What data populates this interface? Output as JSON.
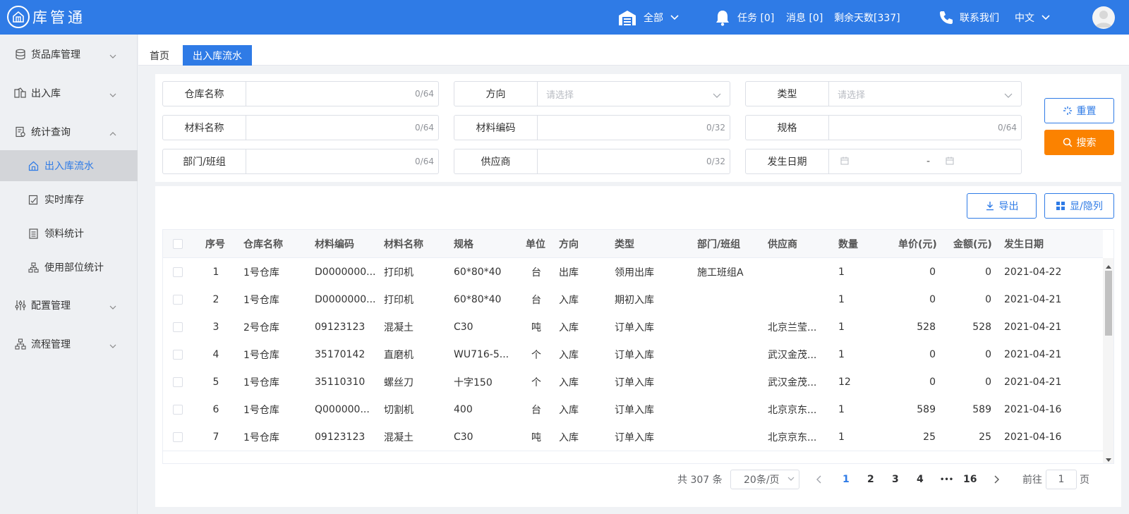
{
  "app": {
    "name": "库管通"
  },
  "header": {
    "warehouse_label": "全部",
    "tasks": "任务 [0]",
    "messages": "消息 [0]",
    "remaining_days": "剩余天数[337]",
    "contact": "联系我们",
    "language": "中文"
  },
  "sidebar": {
    "items": [
      {
        "label": "货品库管理",
        "icon": "database-icon",
        "expanded": false
      },
      {
        "label": "出入库",
        "icon": "swap-icon",
        "expanded": false
      },
      {
        "label": "统计查询",
        "icon": "stats-icon",
        "expanded": true
      },
      {
        "label": "配置管理",
        "icon": "sliders-icon",
        "expanded": false
      },
      {
        "label": "流程管理",
        "icon": "flow-icon",
        "expanded": false
      }
    ],
    "sub_items": [
      {
        "label": "出入库流水",
        "icon": "home-icon",
        "active": true
      },
      {
        "label": "实时库存",
        "icon": "inventory-icon",
        "active": false
      },
      {
        "label": "领料统计",
        "icon": "list-icon",
        "active": false
      },
      {
        "label": "使用部位统计",
        "icon": "hierarchy-icon",
        "active": false
      }
    ]
  },
  "tabs": [
    {
      "label": "首页",
      "active": false
    },
    {
      "label": "出入库流水",
      "active": true
    }
  ],
  "filters": {
    "warehouse_name": {
      "label": "仓库名称",
      "counter": "0/64"
    },
    "direction": {
      "label": "方向",
      "placeholder": "请选择"
    },
    "type": {
      "label": "类型",
      "placeholder": "请选择"
    },
    "material_name": {
      "label": "材料名称",
      "counter": "0/64"
    },
    "material_code": {
      "label": "材料编码",
      "counter": "0/32"
    },
    "spec": {
      "label": "规格",
      "counter": "0/64"
    },
    "department": {
      "label": "部门/班组",
      "counter": "0/64"
    },
    "supplier": {
      "label": "供应商",
      "counter": "0/32"
    },
    "date": {
      "label": "发生日期",
      "separator": "-"
    }
  },
  "buttons": {
    "reset": "重置",
    "search": "搜索",
    "export": "导出",
    "toggle_columns": "显/隐列"
  },
  "table": {
    "headers": [
      "序号",
      "仓库名称",
      "材料编码",
      "材料名称",
      "规格",
      "单位",
      "方向",
      "类型",
      "部门/班组",
      "供应商",
      "数量",
      "单价(元)",
      "金额(元)",
      "发生日期"
    ],
    "rows": [
      [
        "1",
        "1号仓库",
        "D0000000...",
        "打印机",
        "60*80*40",
        "台",
        "出库",
        "领用出库",
        "施工班组A",
        "",
        "1",
        "0",
        "0",
        "2021-04-22"
      ],
      [
        "2",
        "1号仓库",
        "D0000000...",
        "打印机",
        "60*80*40",
        "台",
        "入库",
        "期初入库",
        "",
        "",
        "1",
        "0",
        "0",
        "2021-04-21"
      ],
      [
        "3",
        "2号仓库",
        "09123123",
        "混凝土",
        "C30",
        "吨",
        "入库",
        "订单入库",
        "",
        "北京兰莹...",
        "1",
        "528",
        "528",
        "2021-04-21"
      ],
      [
        "4",
        "1号仓库",
        "35170142",
        "直磨机",
        "WU716-5...",
        "个",
        "入库",
        "订单入库",
        "",
        "武汉金茂...",
        "1",
        "0",
        "0",
        "2021-04-21"
      ],
      [
        "5",
        "1号仓库",
        "35110310",
        "螺丝刀",
        "十字150",
        "个",
        "入库",
        "订单入库",
        "",
        "武汉金茂...",
        "12",
        "0",
        "0",
        "2021-04-21"
      ],
      [
        "6",
        "1号仓库",
        "Q000000...",
        "切割机",
        "400",
        "台",
        "入库",
        "订单入库",
        "",
        "北京京东...",
        "1",
        "589",
        "589",
        "2021-04-16"
      ],
      [
        "7",
        "1号仓库",
        "09123123",
        "混凝土",
        "C30",
        "吨",
        "入库",
        "订单入库",
        "",
        "北京京东...",
        "1",
        "25",
        "25",
        "2021-04-16"
      ]
    ]
  },
  "pagination": {
    "total": "共 307 条",
    "page_size": "20条/页",
    "pages": [
      "1",
      "2",
      "3",
      "4",
      "16"
    ],
    "ellipsis": "•••",
    "current": "1",
    "goto_prefix": "前往",
    "goto_value": "1",
    "goto_suffix": "页"
  },
  "colors": {
    "primary": "#2f7be6",
    "orange": "#fb8200",
    "sidebar_bg": "#eef0f3"
  }
}
